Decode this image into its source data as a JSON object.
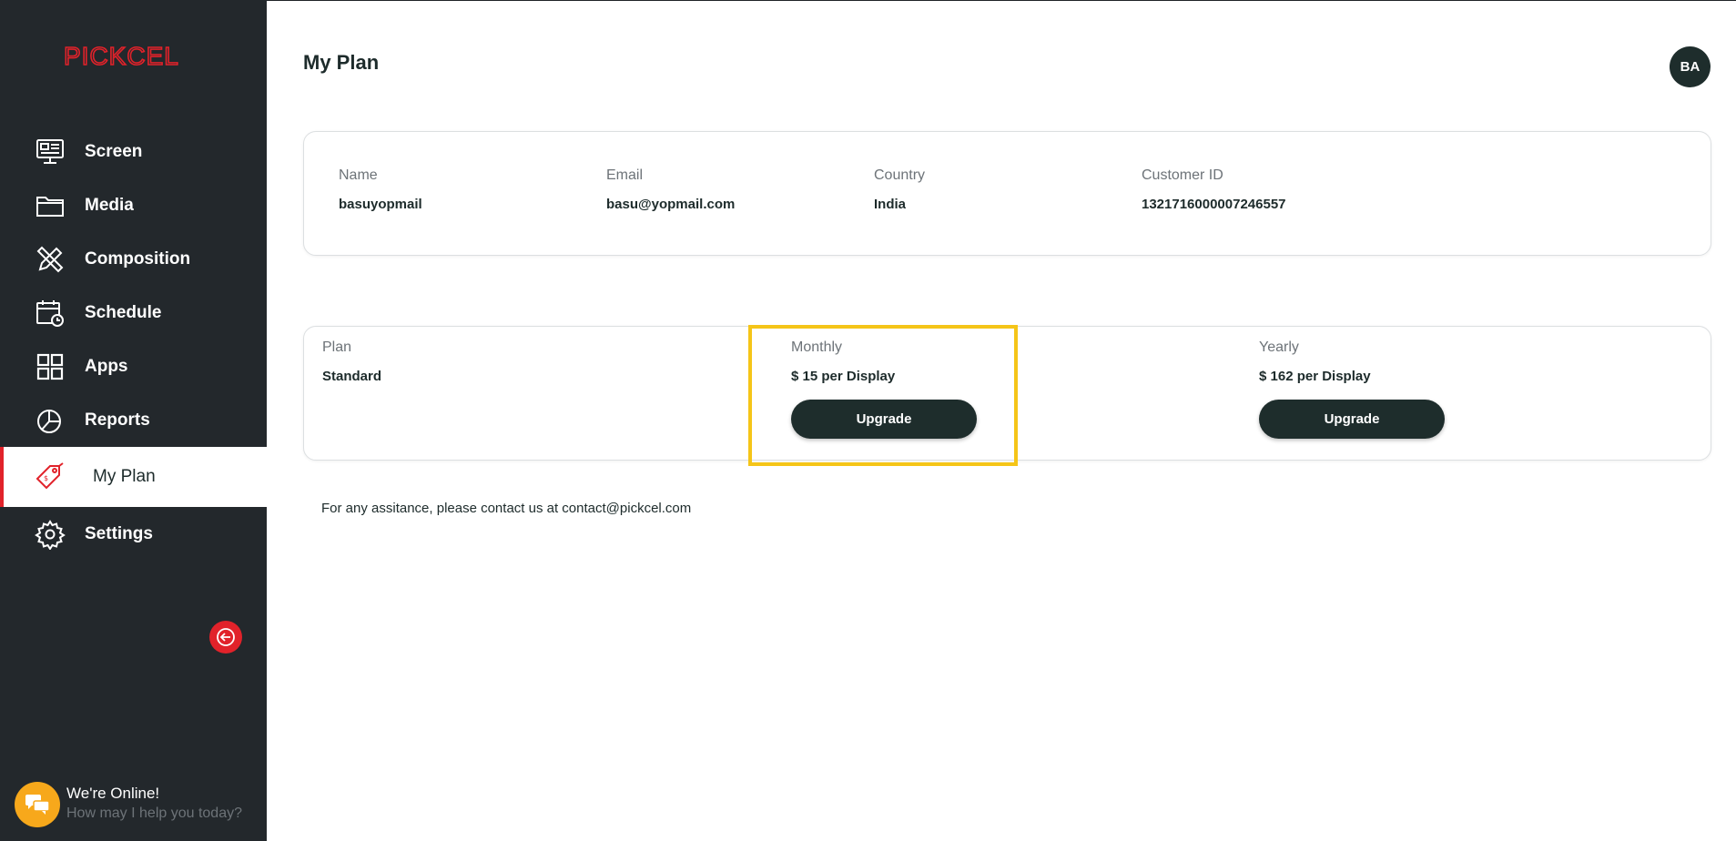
{
  "brand": {
    "logo_text": "PICKCEL",
    "accent": "#e1222a"
  },
  "sidebar": {
    "items": [
      {
        "label": "Screen",
        "icon": "monitor-icon"
      },
      {
        "label": "Media",
        "icon": "folder-icon"
      },
      {
        "label": "Composition",
        "icon": "pencil-ruler-icon"
      },
      {
        "label": "Schedule",
        "icon": "calendar-clock-icon"
      },
      {
        "label": "Apps",
        "icon": "grid-icon"
      },
      {
        "label": "Reports",
        "icon": "pie-chart-icon"
      },
      {
        "label": "My Plan",
        "icon": "price-tag-icon",
        "active": true
      },
      {
        "label": "Settings",
        "icon": "gear-icon"
      }
    ],
    "collapse_icon": "arrow-left-icon"
  },
  "chat": {
    "title": "We're Online!",
    "subtitle": "How may I help you today?",
    "icon": "chat-bubbles-icon"
  },
  "header": {
    "title": "My Plan",
    "avatar_initials": "BA"
  },
  "account": {
    "name_label": "Name",
    "name_value": "basuyopmail",
    "email_label": "Email",
    "email_value": "basu@yopmail.com",
    "country_label": "Country",
    "country_value": "India",
    "customer_id_label": "Customer ID",
    "customer_id_value": "1321716000007246557"
  },
  "plan": {
    "plan_label": "Plan",
    "plan_value": "Standard",
    "monthly_label": "Monthly",
    "monthly_value": "$ 15 per Display",
    "monthly_button": "Upgrade",
    "yearly_label": "Yearly",
    "yearly_value": "$ 162 per Display",
    "yearly_button": "Upgrade",
    "highlight_color": "#f5c518"
  },
  "footer": {
    "assistance_text": "For any assitance, please contact us at contact@pickcel.com"
  }
}
